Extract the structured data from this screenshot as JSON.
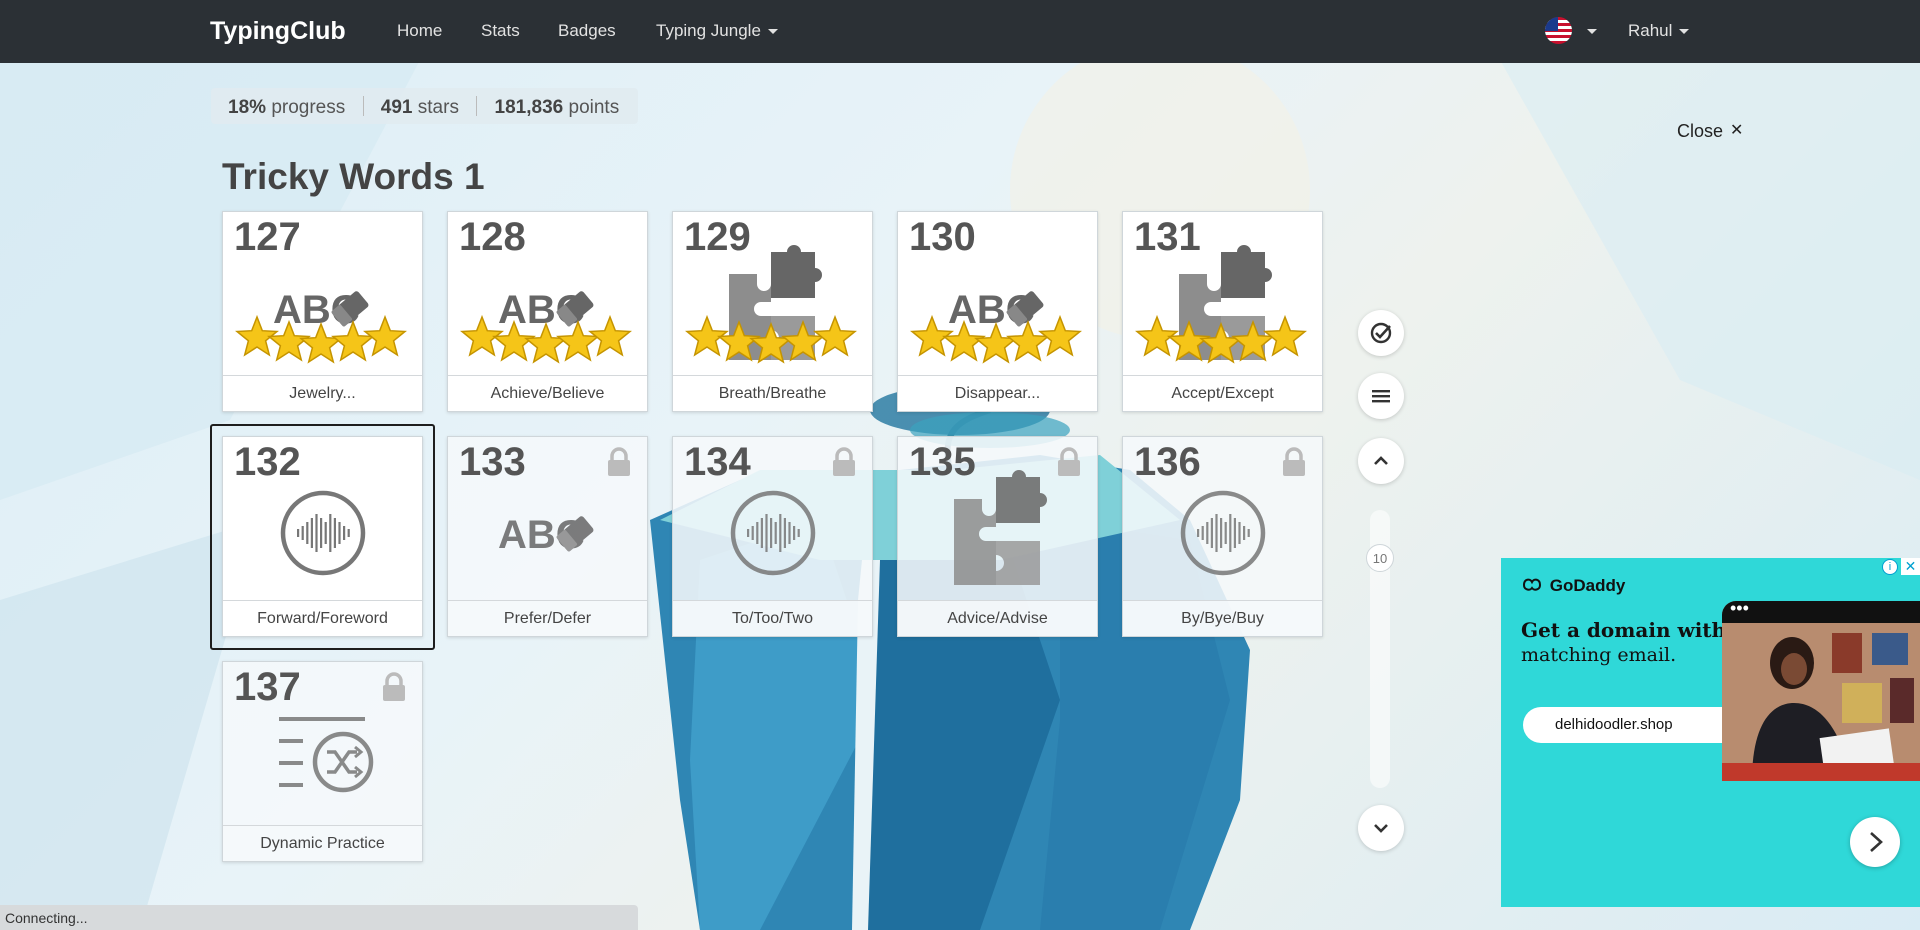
{
  "navbar": {
    "brand": "TypingClub",
    "links": [
      "Home",
      "Stats",
      "Badges",
      "Typing Jungle"
    ],
    "user": "Rahul",
    "flag_icon": "us-flag-icon"
  },
  "progress": {
    "percent": "18%",
    "percent_label": "progress",
    "stars": "491",
    "stars_label": "stars",
    "points": "181,836",
    "points_label": "points"
  },
  "close_label": "Close",
  "close_glyph": "✕",
  "section_title": "Tricky Words 1",
  "lessons": [
    {
      "num": "127",
      "label": "Jewelry...",
      "icon": "abc-eraser-icon",
      "stars": 5,
      "locked": false
    },
    {
      "num": "128",
      "label": "Achieve/Believe",
      "icon": "abc-eraser-icon",
      "stars": 5,
      "locked": false
    },
    {
      "num": "129",
      "label": "Breath/Breathe",
      "icon": "puzzle-icon",
      "stars": 5,
      "locked": false
    },
    {
      "num": "130",
      "label": "Disappear...",
      "icon": "abc-eraser-icon",
      "stars": 5,
      "locked": false
    },
    {
      "num": "131",
      "label": "Accept/Except",
      "icon": "puzzle-icon",
      "stars": 5,
      "locked": false
    },
    {
      "num": "132",
      "label": "Forward/Foreword",
      "icon": "audio-wave-icon",
      "stars": 0,
      "locked": false
    },
    {
      "num": "133",
      "label": "Prefer/Defer",
      "icon": "abc-eraser-icon",
      "stars": 0,
      "locked": true
    },
    {
      "num": "134",
      "label": "To/Too/Two",
      "icon": "audio-wave-icon",
      "stars": 0,
      "locked": true
    },
    {
      "num": "135",
      "label": "Advice/Advise",
      "icon": "puzzle-icon",
      "stars": 0,
      "locked": true
    },
    {
      "num": "136",
      "label": "By/Bye/Buy",
      "icon": "audio-wave-icon",
      "stars": 0,
      "locked": true
    },
    {
      "num": "137",
      "label": "Dynamic Practice",
      "icon": "shuffle-list-icon",
      "stars": 0,
      "locked": true
    }
  ],
  "abc_text": "ABC",
  "side_controls": {
    "scroll_value": "10"
  },
  "ad": {
    "brand": "GoDaddy",
    "headline": "Get a domain with",
    "subline": "matching email.",
    "search_value": "delhidoodler.shop",
    "info_glyph": "i",
    "close_glyph": "✕",
    "photo_dots": "•••"
  },
  "status_text": "Connecting..."
}
